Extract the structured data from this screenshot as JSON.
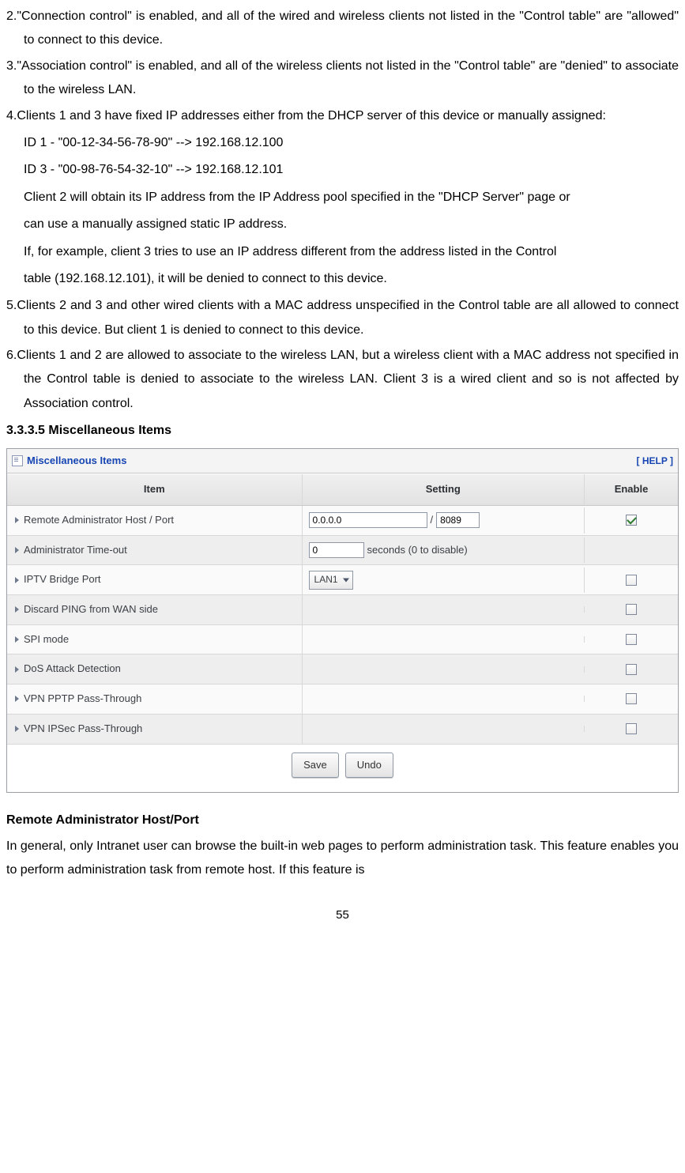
{
  "items": {
    "i2": "2.\"Connection control\" is enabled, and all of the wired and wireless clients not listed in the \"Control table\" are \"allowed\" to connect to this device.",
    "i3": "3.\"Association control\" is enabled, and all of the wireless clients not listed in the \"Control table\" are \"denied\" to associate to the wireless LAN.",
    "i4_head": "4.Clients 1 and 3 have fixed IP addresses either from the DHCP server of this device or manually assigned:",
    "i4_l1": "ID 1 - \"00-12-34-56-78-90\" --> 192.168.12.100",
    "i4_l2": "ID 3 - \"00-98-76-54-32-10\" --> 192.168.12.101",
    "i4_l3": "Client 2 will obtain its IP address from the IP Address pool specified in the \"DHCP Server\" page or",
    "i4_l4": "can use a manually assigned static IP address.",
    "i4_l5": "If, for example, client 3 tries to use an IP address different from the address listed in the Control",
    "i4_l6": "table (192.168.12.101), it will be denied to connect to this device.",
    "i5": "5.Clients 2 and 3 and other wired clients with a MAC address unspecified in the Control table are all allowed to connect to this device. But client 1 is denied to connect to this device.",
    "i6": "6.Clients 1 and 2 are allowed to associate to the wireless LAN, but a wireless client with a MAC address not specified in the Control table is denied to associate to the wireless LAN. Client 3 is a wired client and so is not affected by Association control.",
    "sec_title": "3.3.3.5 Miscellaneous Items"
  },
  "panel": {
    "title": "Miscellaneous Items",
    "help": "[ HELP ]",
    "h_item": "Item",
    "h_set": "Setting",
    "h_en": "Enable",
    "rows": {
      "r0": {
        "label": "Remote Administrator Host / Port",
        "host": "0.0.0.0",
        "sep": "/",
        "port": "8089",
        "checked": true
      },
      "r1": {
        "label": "Administrator Time-out",
        "val": "0",
        "suffix": "seconds (0 to disable)"
      },
      "r2": {
        "label": "IPTV Bridge Port",
        "sel": "LAN1",
        "checked": false
      },
      "r3": {
        "label": "Discard PING from WAN side",
        "checked": false
      },
      "r4": {
        "label": "SPI mode",
        "checked": false
      },
      "r5": {
        "label": "DoS Attack Detection",
        "checked": false
      },
      "r6": {
        "label": "VPN PPTP Pass-Through",
        "checked": false
      },
      "r7": {
        "label": "VPN IPSec Pass-Through",
        "checked": false
      }
    },
    "save": "Save",
    "undo": "Undo"
  },
  "tail": {
    "h": "Remote Administrator Host/Port",
    "p1": "In general, only Intranet user can browse the built-in web pages to perform administration task. This feature enables you to perform administration task from remote host. If this feature is"
  },
  "page": "55"
}
